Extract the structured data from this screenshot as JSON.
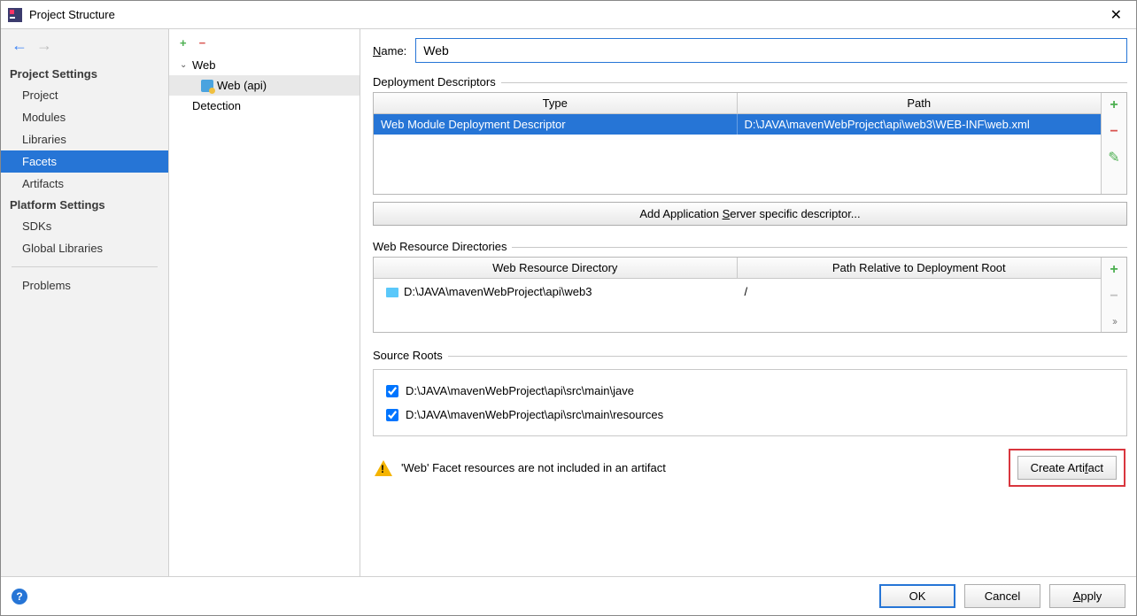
{
  "window": {
    "title": "Project Structure"
  },
  "sidebar": {
    "section1_title": "Project Settings",
    "items1": [
      "Project",
      "Modules",
      "Libraries",
      "Facets",
      "Artifacts"
    ],
    "section2_title": "Platform Settings",
    "items2": [
      "SDKs",
      "Global Libraries"
    ],
    "problems": "Problems"
  },
  "tree": {
    "root": "Web",
    "child": "Web (api)",
    "detection": "Detection"
  },
  "form": {
    "name_label": "Name:",
    "name_value": "Web",
    "dd_label": "Deployment Descriptors",
    "dd_headers": {
      "type": "Type",
      "path": "Path"
    },
    "dd_row": {
      "type": "Web Module Deployment Descriptor",
      "path": "D:\\JAVA\\mavenWebProject\\api\\web3\\WEB-INF\\web.xml"
    },
    "add_server_pre": "Add Application ",
    "add_server_key": "S",
    "add_server_post": "erver specific descriptor...",
    "rd_label": "Web Resource Directories",
    "rd_headers": {
      "dir": "Web Resource Directory",
      "rel": "Path Relative to Deployment Root"
    },
    "rd_row": {
      "dir": "D:\\JAVA\\mavenWebProject\\api\\web3",
      "rel": "/"
    },
    "sr_label": "Source Roots",
    "sr_items": [
      "D:\\JAVA\\mavenWebProject\\api\\src\\main\\jave",
      "D:\\JAVA\\mavenWebProject\\api\\src\\main\\resources"
    ],
    "warning_text": "'Web' Facet resources are not included in an artifact",
    "create_pre": "Create Arti",
    "create_key": "f",
    "create_post": "act"
  },
  "footer": {
    "ok": "OK",
    "cancel": "Cancel",
    "apply": "Apply"
  }
}
